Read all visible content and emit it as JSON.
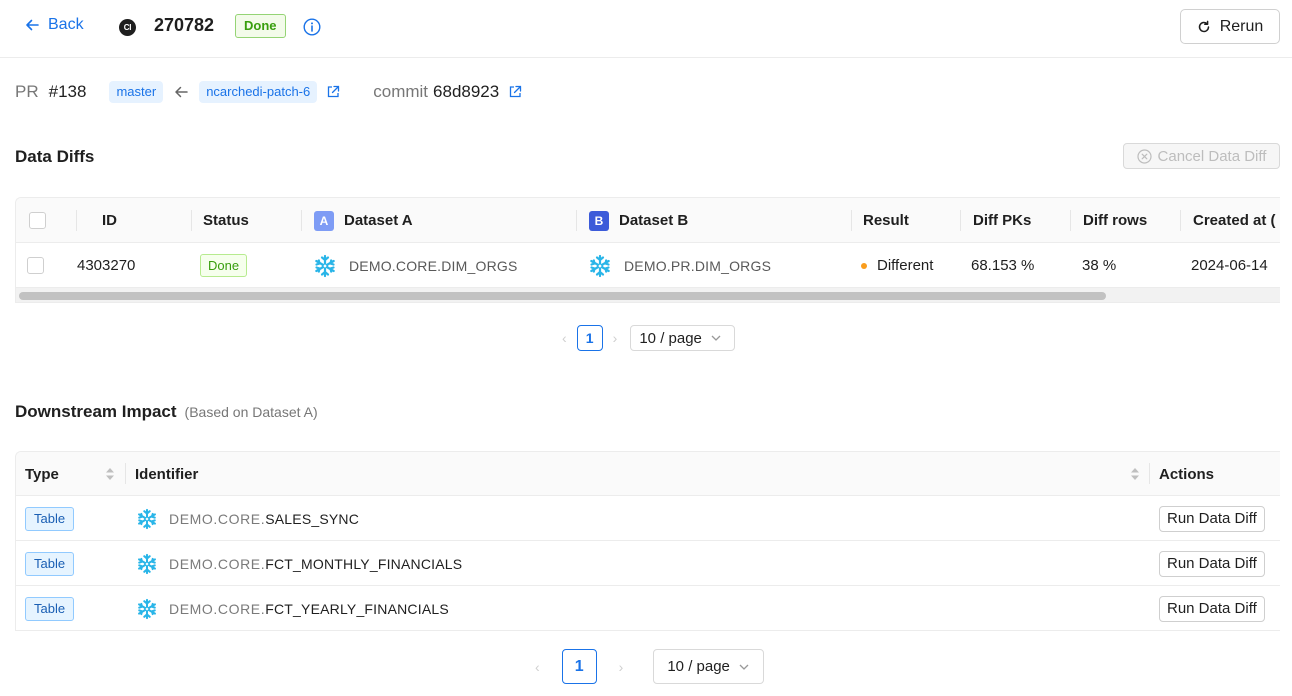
{
  "header": {
    "back_label": "Back",
    "ci_icon_text": "CI",
    "run_id": "270782",
    "status": "Done",
    "rerun_label": "Rerun"
  },
  "pr": {
    "label": "PR",
    "number": "#138",
    "base_branch": "master",
    "head_branch": "ncarchedi-patch-6",
    "commit_label": "commit",
    "commit_sha": "68d8923"
  },
  "data_diffs": {
    "title": "Data Diffs",
    "cancel_label": "Cancel Data Diff",
    "columns": {
      "id": "ID",
      "status": "Status",
      "dataset_a_badge": "A",
      "dataset_a": "Dataset A",
      "dataset_b_badge": "B",
      "dataset_b": "Dataset B",
      "result": "Result",
      "diff_pks": "Diff PKs",
      "diff_rows": "Diff rows",
      "created_at": "Created at ("
    },
    "rows": [
      {
        "id": "4303270",
        "status": "Done",
        "dataset_a": "DEMO.CORE.DIM_ORGS",
        "dataset_b": "DEMO.PR.DIM_ORGS",
        "result": "Different",
        "diff_pks": "68.153 %",
        "diff_rows": "38 %",
        "created_at": "2024-06-14"
      }
    ],
    "pagination": {
      "page": "1",
      "page_size": "10 / page"
    }
  },
  "downstream": {
    "title": "Downstream Impact",
    "subtitle": "(Based on Dataset A)",
    "columns": {
      "type": "Type",
      "identifier": "Identifier",
      "actions": "Actions"
    },
    "rows": [
      {
        "type": "Table",
        "prefix": "DEMO.CORE.",
        "name": "SALES_SYNC",
        "action": "Run Data Diff"
      },
      {
        "type": "Table",
        "prefix": "DEMO.CORE.",
        "name": "FCT_MONTHLY_FINANCIALS",
        "action": "Run Data Diff"
      },
      {
        "type": "Table",
        "prefix": "DEMO.CORE.",
        "name": "FCT_YEARLY_FINANCIALS",
        "action": "Run Data Diff"
      }
    ],
    "pagination": {
      "page": "1",
      "page_size": "10 / page"
    }
  },
  "colors": {
    "accent": "#1a73e8",
    "success": "#389e0d",
    "warning_dot": "#fa9d1c",
    "snowflake": "#29b5e8"
  }
}
